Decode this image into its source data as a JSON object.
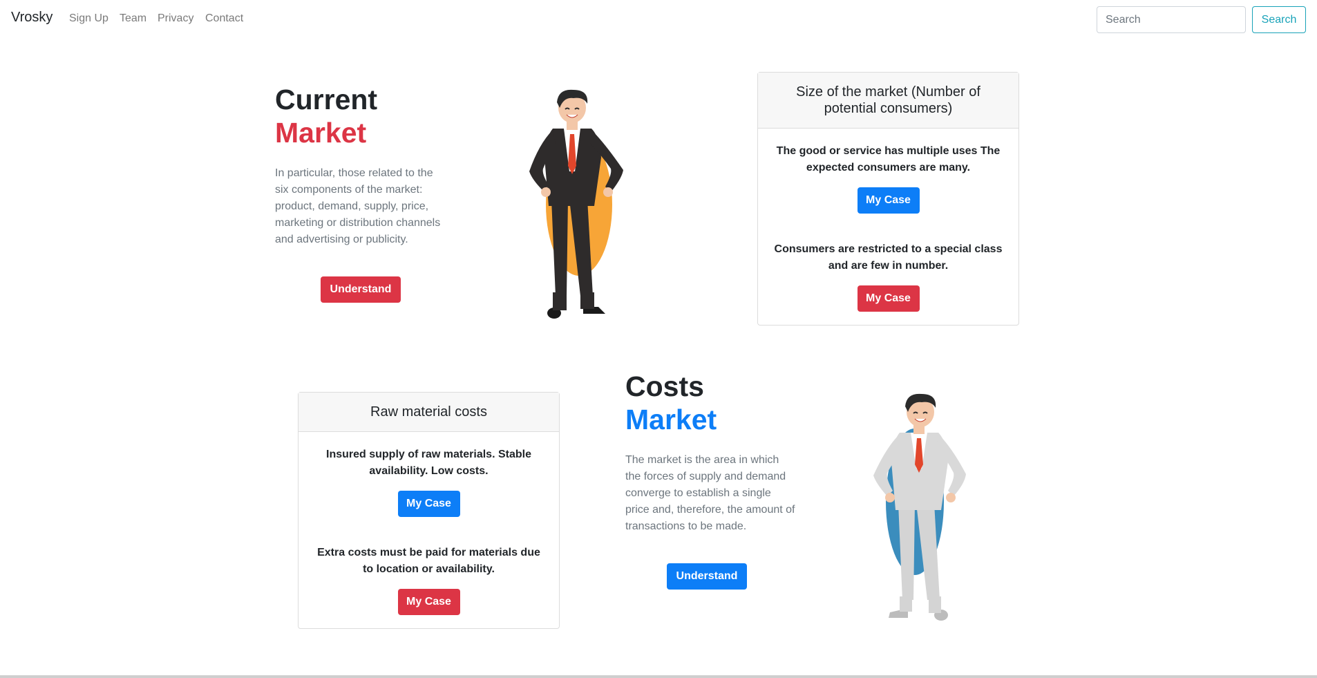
{
  "navbar": {
    "brand": "Vrosky",
    "links": [
      "Sign Up",
      "Team",
      "Privacy",
      "Contact"
    ],
    "search_placeholder": "Search",
    "search_button": "Search"
  },
  "current_market": {
    "title_line1": "Current",
    "title_line2": "Market",
    "description": "In particular, those related to the six components of the market: product, demand, supply, price, marketing or distribution channels and advertising or publicity.",
    "button": "Understand"
  },
  "market_size_card": {
    "header": "Size of the market (Number of potential consumers)",
    "items": [
      {
        "text": "The good or service has multiple uses The expected consumers are many.",
        "button": "My Case"
      },
      {
        "text": "Consumers are restricted to a special class and are few in number.",
        "button": "My Case"
      }
    ]
  },
  "raw_material_card": {
    "header": "Raw material costs",
    "items": [
      {
        "text": "Insured supply of raw materials. Stable availability. Low costs.",
        "button": "My Case"
      },
      {
        "text": "Extra costs must be paid for materials due to location or availability.",
        "button": "My Case"
      }
    ]
  },
  "costs_market": {
    "title_line1": "Costs",
    "title_line2": "Market",
    "description": "The market is the area in which the forces of supply and demand converge to establish a single price and, therefore, the amount of transactions to be made.",
    "button": "Understand"
  },
  "colors": {
    "red": "#dc3545",
    "blue": "#0d7ef7",
    "teal": "#17a2b8",
    "orange_blob": "#f7a537",
    "blue_blob": "#3b8dbd"
  },
  "icons": {
    "figure_1": "businessman-dark-suit-illustration",
    "figure_2": "businessman-grey-suit-illustration"
  }
}
